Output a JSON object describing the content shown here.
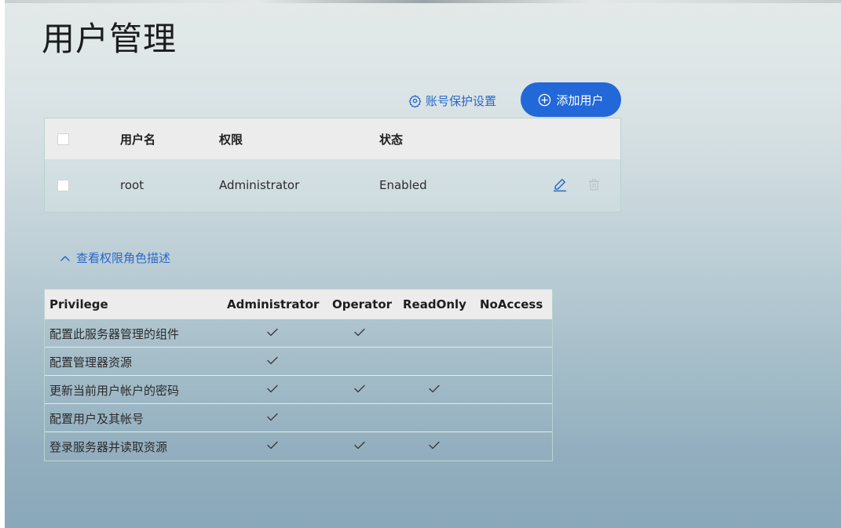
{
  "page": {
    "title": "用户管理"
  },
  "toolbar": {
    "protect_settings_label": "账号保护设置",
    "add_user_label": "添加用户"
  },
  "users_table": {
    "headers": {
      "username": "用户名",
      "privilege": "权限",
      "status": "状态"
    },
    "rows": [
      {
        "username": "root",
        "privilege": "Administrator",
        "status": "Enabled"
      }
    ]
  },
  "roles_toggle": {
    "label": "查看权限角色描述",
    "expanded": true
  },
  "privilege_table": {
    "headers": [
      "Privilege",
      "Administrator",
      "Operator",
      "ReadOnly",
      "NoAccess"
    ],
    "rows": [
      {
        "name": "配置此服务器管理的组件",
        "administrator": true,
        "operator": true,
        "readonly": false,
        "noaccess": false
      },
      {
        "name": "配置管理器资源",
        "administrator": true,
        "operator": false,
        "readonly": false,
        "noaccess": false
      },
      {
        "name": "更新当前用户帐户的密码",
        "administrator": true,
        "operator": true,
        "readonly": true,
        "noaccess": false
      },
      {
        "name": "配置用户及其帐号",
        "administrator": true,
        "operator": false,
        "readonly": false,
        "noaccess": false
      },
      {
        "name": "登录服务器并读取资源",
        "administrator": true,
        "operator": true,
        "readonly": true,
        "noaccess": false
      }
    ]
  },
  "icons": {
    "protect_settings": "gear-icon",
    "add_user": "plus-circle-icon",
    "edit": "pencil-icon",
    "delete": "trash-icon",
    "toggle": "chevron-up-icon",
    "check": "checkmark-icon"
  },
  "colors": {
    "accent": "#2268d8",
    "link": "#2a69c9",
    "header_bg": "#ececec",
    "border": "#b9d4cf",
    "delete_disabled": "#b9c3c8"
  }
}
